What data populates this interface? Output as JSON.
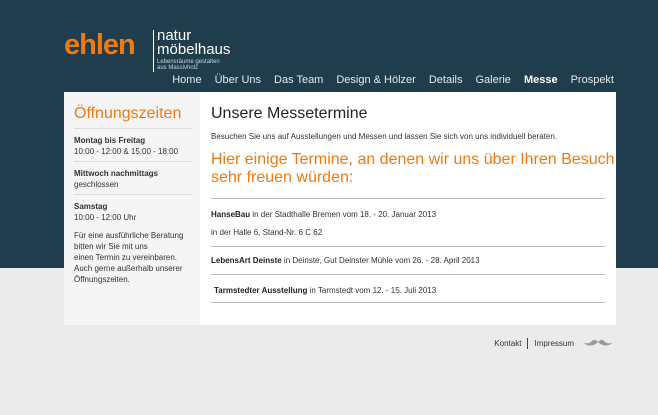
{
  "logo": {
    "brand": "ehlen",
    "natur": "natur",
    "moebelhaus": "möbelhaus",
    "tagline_1": "Lebensräume gestalten",
    "tagline_2": "aus Massivholz"
  },
  "nav": {
    "items": [
      {
        "label": "Home"
      },
      {
        "label": "Über Uns"
      },
      {
        "label": "Das Team"
      },
      {
        "label": "Design & Hölzer"
      },
      {
        "label": "Details"
      },
      {
        "label": "Galerie"
      },
      {
        "label": "Messe",
        "active": true
      },
      {
        "label": "Prospekt"
      }
    ]
  },
  "sidebar": {
    "title": "Öffnungszeiten",
    "blocks": [
      {
        "heading": "Montag bis Freitag",
        "text": "10:00 - 12:00 & 15:00 - 18:00"
      },
      {
        "heading": "Mittwoch nachmittags",
        "text": "geschlossen"
      },
      {
        "heading": "Samstag",
        "text": "10:00 - 12:00 Uhr"
      }
    ],
    "note_lines": [
      "Für eine ausführliche Beratung",
      "bitten wir Sie mit uns",
      "einen Termin zu vereinbaren.",
      "Auch gerne außerhalb unserer",
      "Öffnungszeiten."
    ]
  },
  "main": {
    "title": "Unsere Messetermine",
    "intro": "Besuchen Sie uns auf Ausstellungen und Messen und lassen Sie sich von uns individuell beraten.",
    "headline_line_1": "Hier einige Termine, an denen wir uns über Ihren Besuch",
    "headline_line_2": "sehr freuen würden:",
    "events": [
      {
        "name": "HanseBau",
        "detail": " in der Stadthalle Bremen vom 18. - 20. Januar 2013",
        "extra": "in der Halle 6, Stand-Nr. 6 C 62"
      },
      {
        "name": "LebensArt Deinste",
        "detail": " in Deinste, Gut Deinster Mühle vom 26. - 28. April 2013"
      },
      {
        "name": "Tarmstedter Ausstellung",
        "detail": " in Tarmstedt vom 12. - 15. Juli 2013"
      }
    ]
  },
  "footer": {
    "kontakt": "Kontakt",
    "impressum": "Impressum"
  },
  "colors": {
    "header_bg": "#1f3d4c",
    "accent": "#f07a10",
    "page_bg": "#ebebeb"
  }
}
